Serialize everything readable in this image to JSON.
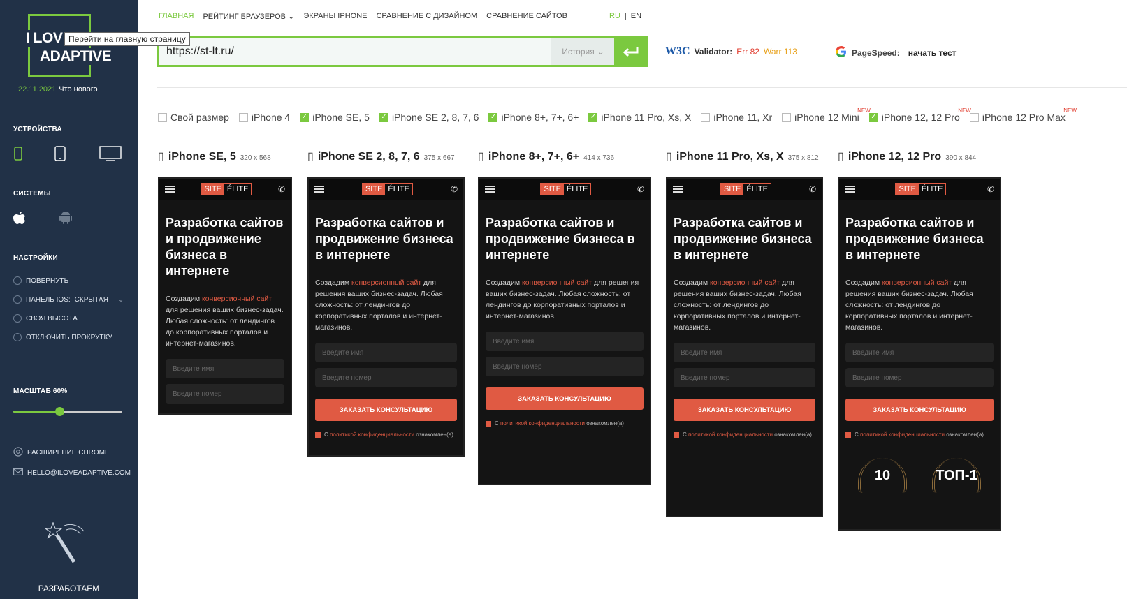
{
  "sidebar": {
    "logo_line1": "I LOV",
    "logo_line2": "ADAPTIVE",
    "tooltip": "Перейти на главную страницу",
    "date": "22.11.2021",
    "whats_new": "Что нового",
    "devices_heading": "УСТРОЙСТВА",
    "systems_heading": "СИСТЕМЫ",
    "settings_heading": "НАСТРОЙКИ",
    "settings": [
      {
        "label": "ПОВЕРНУТЬ"
      },
      {
        "label": "ПАНЕЛЬ IOS:",
        "value": "СКРЫТАЯ"
      },
      {
        "label": "СВОЯ ВЫСОТА"
      },
      {
        "label": "ОТКЛЮЧИТЬ ПРОКРУТКУ"
      }
    ],
    "scale_label": "МАСШТАБ",
    "scale_value": "60%",
    "chrome_ext": "РАСШИРЕНИЕ CHROME",
    "email": "HELLO@ILOVEADAPTIVE.COM",
    "develop": "РАЗРАБОТАЕМ"
  },
  "nav": {
    "items": [
      "ГЛАВНАЯ",
      "РЕЙТИНГ БРАУЗЕРОВ",
      "ЭКРАНЫ IPHONE",
      "СРАВНЕНИЕ С ДИЗАЙНОМ",
      "СРАВНЕНИЕ САЙТОВ"
    ],
    "lang_ru": "RU",
    "lang_en": "EN"
  },
  "url": {
    "value": "https://st-lt.ru/",
    "history": "История"
  },
  "validator": {
    "logo": "W3C",
    "label": "Validator:",
    "err": "Err 82",
    "warr": "Warr 113"
  },
  "pagespeed": {
    "label": "PageSpeed:",
    "run": "начать тест"
  },
  "checkboxes": [
    {
      "label": "Свой размер",
      "checked": false,
      "new": ""
    },
    {
      "label": "iPhone 4",
      "checked": false,
      "new": ""
    },
    {
      "label": "iPhone SE, 5",
      "checked": true,
      "new": ""
    },
    {
      "label": "iPhone SE 2, 8, 7, 6",
      "checked": true,
      "new": ""
    },
    {
      "label": "iPhone 8+, 7+, 6+",
      "checked": true,
      "new": ""
    },
    {
      "label": "iPhone 11 Pro, Xs, X",
      "checked": true,
      "new": ""
    },
    {
      "label": "iPhone 11, Xr",
      "checked": false,
      "new": ""
    },
    {
      "label": "iPhone 12 Mini",
      "checked": false,
      "new": "NEW"
    },
    {
      "label": "iPhone 12, 12 Pro",
      "checked": true,
      "new": "NEW"
    },
    {
      "label": "iPhone 12 Pro Max",
      "checked": false,
      "new": "NEW"
    }
  ],
  "devices": [
    {
      "name": "iPhone SE, 5",
      "size": "320 x 568"
    },
    {
      "name": "iPhone SE 2, 8, 7, 6",
      "size": "375 x 667"
    },
    {
      "name": "iPhone 8+, 7+, 6+",
      "size": "414 x 736"
    },
    {
      "name": "iPhone 11 Pro, Xs, X",
      "size": "375 x 812"
    },
    {
      "name": "iPhone 12, 12 Pro",
      "size": "390 x 844"
    }
  ],
  "site": {
    "brand_a": "SITE",
    "brand_b": "ÉLITE",
    "heading": "Разработка сайтов и продвижение бизнеса в интернете",
    "p_before": "Создадим ",
    "p_highlight": "конверсионный сайт",
    "p_after": " для решения ваших бизнес-задач. Любая сложность: от лендингов до корпоративных порталов и интернет-магазинов.",
    "name_placeholder": "Введите имя",
    "phone_placeholder": "Введите номер",
    "button": "ЗАКАЗАТЬ КОНСУЛЬТАЦИЮ",
    "consent_before": "С ",
    "consent_link": "политикой конфиденциальности",
    "consent_after": " ознакомлен(а)",
    "award1": "10",
    "award2": "ТОП-1"
  }
}
